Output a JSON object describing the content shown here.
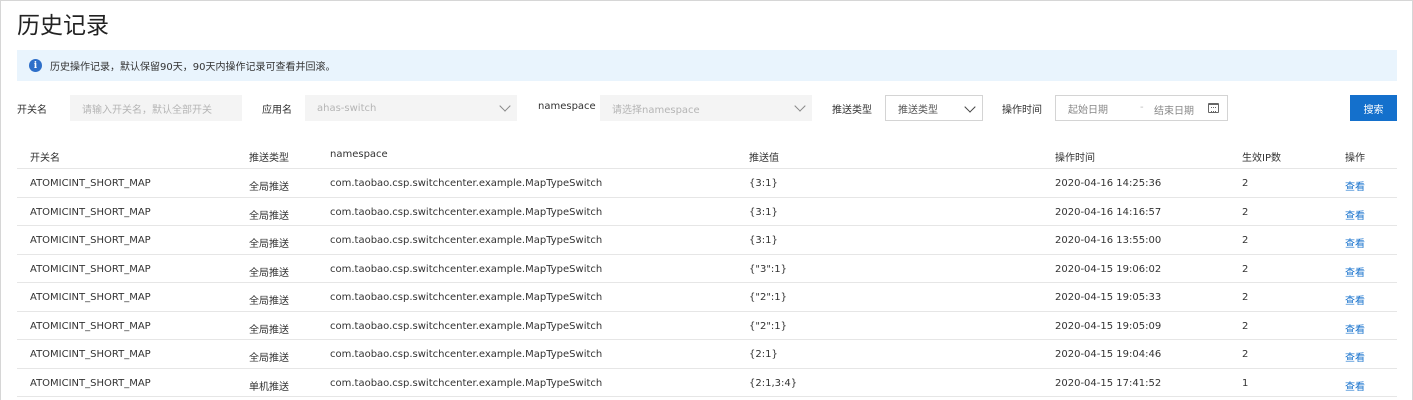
{
  "page": {
    "title": "历史记录"
  },
  "notice": {
    "text": "历史操作记录，默认保留90天，90天内操作记录可查看并回滚。"
  },
  "filters": {
    "switch_name_label": "开关名",
    "switch_name_placeholder": "请输入开关名，默认全部开关",
    "app_label": "应用名",
    "app_value": "ahas-switch",
    "namespace_label": "namespace",
    "namespace_placeholder": "请选择namespace",
    "push_type_label": "推送类型",
    "push_type_value": "推送类型",
    "op_time_label": "操作时间",
    "start_date_placeholder": "起始日期",
    "date_separator": "-",
    "end_date_placeholder": "结束日期",
    "search_label": "搜索"
  },
  "table": {
    "columns": [
      "开关名",
      "推送类型",
      "namespace",
      "推送值",
      "操作时间",
      "生效IP数",
      "操作"
    ],
    "rows": [
      {
        "name": "ATOMICINT_SHORT_MAP",
        "type": "全局推送",
        "ns": "com.taobao.csp.switchcenter.example.MapTypeSwitch",
        "value": "{3:1}",
        "time": "2020-04-16 14:25:36",
        "ips": "2",
        "action": "查看"
      },
      {
        "name": "ATOMICINT_SHORT_MAP",
        "type": "全局推送",
        "ns": "com.taobao.csp.switchcenter.example.MapTypeSwitch",
        "value": "{3:1}",
        "time": "2020-04-16 14:16:57",
        "ips": "2",
        "action": "查看"
      },
      {
        "name": "ATOMICINT_SHORT_MAP",
        "type": "全局推送",
        "ns": "com.taobao.csp.switchcenter.example.MapTypeSwitch",
        "value": "{3:1}",
        "time": "2020-04-16 13:55:00",
        "ips": "2",
        "action": "查看"
      },
      {
        "name": "ATOMICINT_SHORT_MAP",
        "type": "全局推送",
        "ns": "com.taobao.csp.switchcenter.example.MapTypeSwitch",
        "value": "{\"3\":1}",
        "time": "2020-04-15 19:06:02",
        "ips": "2",
        "action": "查看"
      },
      {
        "name": "ATOMICINT_SHORT_MAP",
        "type": "全局推送",
        "ns": "com.taobao.csp.switchcenter.example.MapTypeSwitch",
        "value": "{\"2\":1}",
        "time": "2020-04-15 19:05:33",
        "ips": "2",
        "action": "查看"
      },
      {
        "name": "ATOMICINT_SHORT_MAP",
        "type": "全局推送",
        "ns": "com.taobao.csp.switchcenter.example.MapTypeSwitch",
        "value": "{\"2\":1}",
        "time": "2020-04-15 19:05:09",
        "ips": "2",
        "action": "查看"
      },
      {
        "name": "ATOMICINT_SHORT_MAP",
        "type": "全局推送",
        "ns": "com.taobao.csp.switchcenter.example.MapTypeSwitch",
        "value": "{2:1}",
        "time": "2020-04-15 19:04:46",
        "ips": "2",
        "action": "查看"
      },
      {
        "name": "ATOMICINT_SHORT_MAP",
        "type": "单机推送",
        "ns": "com.taobao.csp.switchcenter.example.MapTypeSwitch",
        "value": "{2:1,3:4}",
        "time": "2020-04-15 17:41:52",
        "ips": "1",
        "action": "查看"
      }
    ]
  },
  "colors": {
    "accent": "#1470cc",
    "notice_bg": "#e9f4fd",
    "info_icon": "#2e6fc9"
  },
  "icons": {
    "notice": "info-icon",
    "select": "chevron-down-icon",
    "date": "calendar-icon"
  }
}
